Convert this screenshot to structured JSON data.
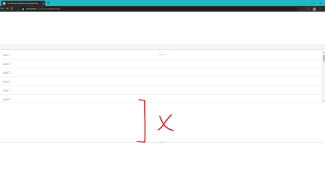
{
  "browser": {
    "tab_title": "localhost:4200/scrollable-test",
    "tab_close": "×",
    "new_tab": "+",
    "url_host": "localhost",
    "url_path": ":4200/scrollable-test",
    "window_controls": [
      "–",
      "▫",
      "×"
    ]
  },
  "toolbar_icons": {
    "back": "←",
    "forward": "→",
    "reload": "↻",
    "star": "☆",
    "menu": "⋮"
  },
  "page": {
    "header_label": "header",
    "rows": [
      {
        "label": "row 1"
      },
      {
        "label": "row 2"
      },
      {
        "label": "row 3"
      },
      {
        "label": "row 4"
      },
      {
        "label": "row 5"
      },
      {
        "label": "row 6"
      }
    ],
    "footer_label": "footer"
  },
  "colors": {
    "tab_strip": "#1fb8c4",
    "toolbar": "#2b2b2b",
    "annotation": "#d8101a"
  }
}
